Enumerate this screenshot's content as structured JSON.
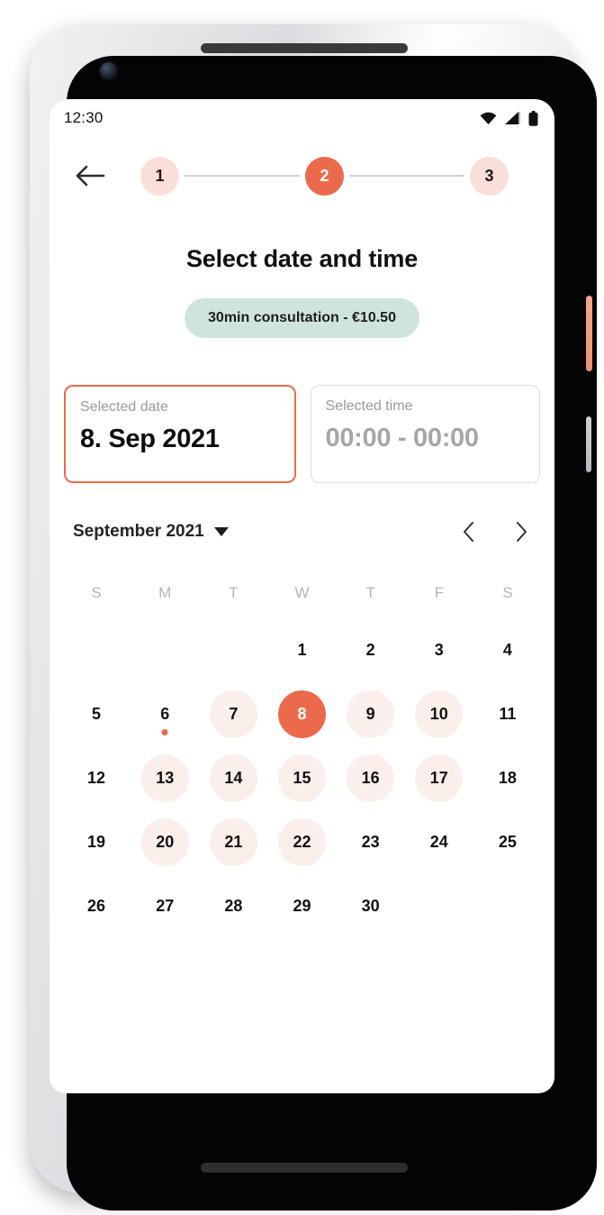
{
  "statusbar": {
    "time": "12:30",
    "icons": [
      "wifi-icon",
      "cellular-signal-icon",
      "battery-icon"
    ]
  },
  "header": {
    "back_icon": "back-arrow-icon",
    "steps": [
      {
        "label": "1",
        "state": "inactive"
      },
      {
        "label": "2",
        "state": "active"
      },
      {
        "label": "3",
        "state": "inactive"
      }
    ]
  },
  "main": {
    "title": "Select date and time",
    "service_chip": "30min consultation - €10.50",
    "cards": [
      {
        "label": "Selected date",
        "value": "8. Sep 2021",
        "state": "selected"
      },
      {
        "label": "Selected time",
        "value": "00:00 - 00:00",
        "state": "empty"
      }
    ]
  },
  "calendar": {
    "month_label": "September 2021",
    "caret_icon": "chevron-down-icon",
    "prev_icon": "chevron-left-icon",
    "next_icon": "chevron-right-icon",
    "weekdays": [
      "S",
      "M",
      "T",
      "W",
      "T",
      "F",
      "S"
    ],
    "weeks": [
      [
        {
          "day": "",
          "state": "blank"
        },
        {
          "day": "",
          "state": "blank"
        },
        {
          "day": "",
          "state": "blank"
        },
        {
          "day": "1",
          "state": "plain"
        },
        {
          "day": "2",
          "state": "plain"
        },
        {
          "day": "3",
          "state": "plain"
        },
        {
          "day": "4",
          "state": "plain"
        }
      ],
      [
        {
          "day": "5",
          "state": "plain"
        },
        {
          "day": "6",
          "state": "today"
        },
        {
          "day": "7",
          "state": "available"
        },
        {
          "day": "8",
          "state": "selected"
        },
        {
          "day": "9",
          "state": "available"
        },
        {
          "day": "10",
          "state": "available"
        },
        {
          "day": "11",
          "state": "plain"
        }
      ],
      [
        {
          "day": "12",
          "state": "plain"
        },
        {
          "day": "13",
          "state": "available"
        },
        {
          "day": "14",
          "state": "available"
        },
        {
          "day": "15",
          "state": "available"
        },
        {
          "day": "16",
          "state": "available"
        },
        {
          "day": "17",
          "state": "available"
        },
        {
          "day": "18",
          "state": "plain"
        }
      ],
      [
        {
          "day": "19",
          "state": "plain"
        },
        {
          "day": "20",
          "state": "available"
        },
        {
          "day": "21",
          "state": "available"
        },
        {
          "day": "22",
          "state": "available"
        },
        {
          "day": "23",
          "state": "plain"
        },
        {
          "day": "24",
          "state": "plain"
        },
        {
          "day": "25",
          "state": "plain"
        }
      ],
      [
        {
          "day": "26",
          "state": "plain"
        },
        {
          "day": "27",
          "state": "plain"
        },
        {
          "day": "28",
          "state": "plain"
        },
        {
          "day": "29",
          "state": "plain"
        },
        {
          "day": "30",
          "state": "plain"
        },
        {
          "day": "",
          "state": "blank"
        },
        {
          "day": "",
          "state": "blank"
        }
      ]
    ]
  },
  "colors": {
    "accent": "#ec6a4c",
    "accent_soft": "#fadeda",
    "accent_faint": "#faefea",
    "chip_mint": "#cfe5dc",
    "muted_text": "#a6a6a6",
    "border_grey": "#dcdcdc"
  },
  "device": {
    "power_button_color": "#ef9e78",
    "volume_button_color": "#c6c6ca"
  }
}
